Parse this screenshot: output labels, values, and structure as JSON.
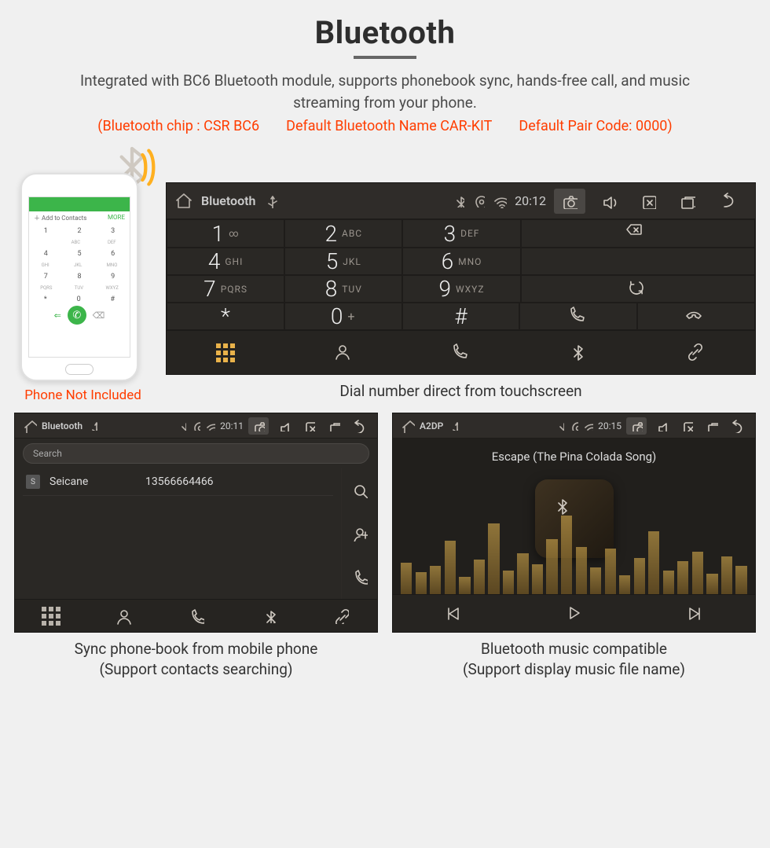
{
  "header": {
    "title": "Bluetooth",
    "desc": "Integrated with BC6 Bluetooth module, supports phonebook sync, hands-free call, and music streaming from your phone.",
    "spec_chip": "(Bluetooth chip : CSR BC6",
    "spec_name": "Default Bluetooth Name CAR-KIT",
    "spec_code": "Default Pair Code: 0000)"
  },
  "phone": {
    "note": "Phone Not Included",
    "add_contacts": "Add to Contacts",
    "more": "MORE"
  },
  "dialer": {
    "statusbar": {
      "title": "Bluetooth",
      "time": "20:12"
    },
    "keys": [
      [
        {
          "n": "1",
          "l": "∞"
        },
        {
          "n": "2",
          "l": "ABC"
        },
        {
          "n": "3",
          "l": "DEF"
        }
      ],
      [
        {
          "n": "4",
          "l": "GHI"
        },
        {
          "n": "5",
          "l": "JKL"
        },
        {
          "n": "6",
          "l": "MNO"
        }
      ],
      [
        {
          "n": "7",
          "l": "PQRS"
        },
        {
          "n": "8",
          "l": "TUV"
        },
        {
          "n": "9",
          "l": "WXYZ"
        }
      ],
      [
        {
          "n": "*",
          "l": ""
        },
        {
          "n": "0",
          "l": "+"
        },
        {
          "n": "#",
          "l": ""
        }
      ]
    ],
    "caption": "Dial number direct from touchscreen"
  },
  "contacts": {
    "statusbar": {
      "title": "Bluetooth",
      "time": "20:11"
    },
    "search_placeholder": "Search",
    "items": [
      {
        "initial": "S",
        "name": "Seicane",
        "number": "13566664466"
      }
    ],
    "caption_l1": "Sync phone-book from mobile phone",
    "caption_l2": "(Support contacts searching)"
  },
  "a2dp": {
    "statusbar": {
      "title": "A2DP",
      "time": "20:15"
    },
    "song": "Escape (The Pina Colada Song)",
    "eq": [
      40,
      28,
      36,
      68,
      22,
      44,
      90,
      30,
      52,
      38,
      70,
      100,
      60,
      34,
      58,
      24,
      46,
      80,
      30,
      42,
      54,
      26,
      48,
      36
    ],
    "caption_l1": "Bluetooth music compatible",
    "caption_l2": "(Support display music file name)"
  },
  "icons": {
    "home": "home-icon",
    "bluetooth": "bluetooth-icon",
    "usb": "usb-icon",
    "location": "location-icon",
    "wifi": "wifi-icon",
    "camera": "camera-icon",
    "volume": "volume-icon",
    "close-box": "close-box-icon",
    "multitask": "multitask-icon",
    "back": "back-icon",
    "backspace": "backspace-icon",
    "refresh": "refresh-icon",
    "call": "call-icon",
    "hangup": "hangup-icon",
    "dialpad": "dialpad-icon",
    "person": "person-icon",
    "phone": "phone-icon",
    "link": "link-icon",
    "search": "search-icon",
    "add-contact": "add-contact-icon",
    "prev": "prev-icon",
    "play": "play-icon",
    "next": "next-icon"
  }
}
